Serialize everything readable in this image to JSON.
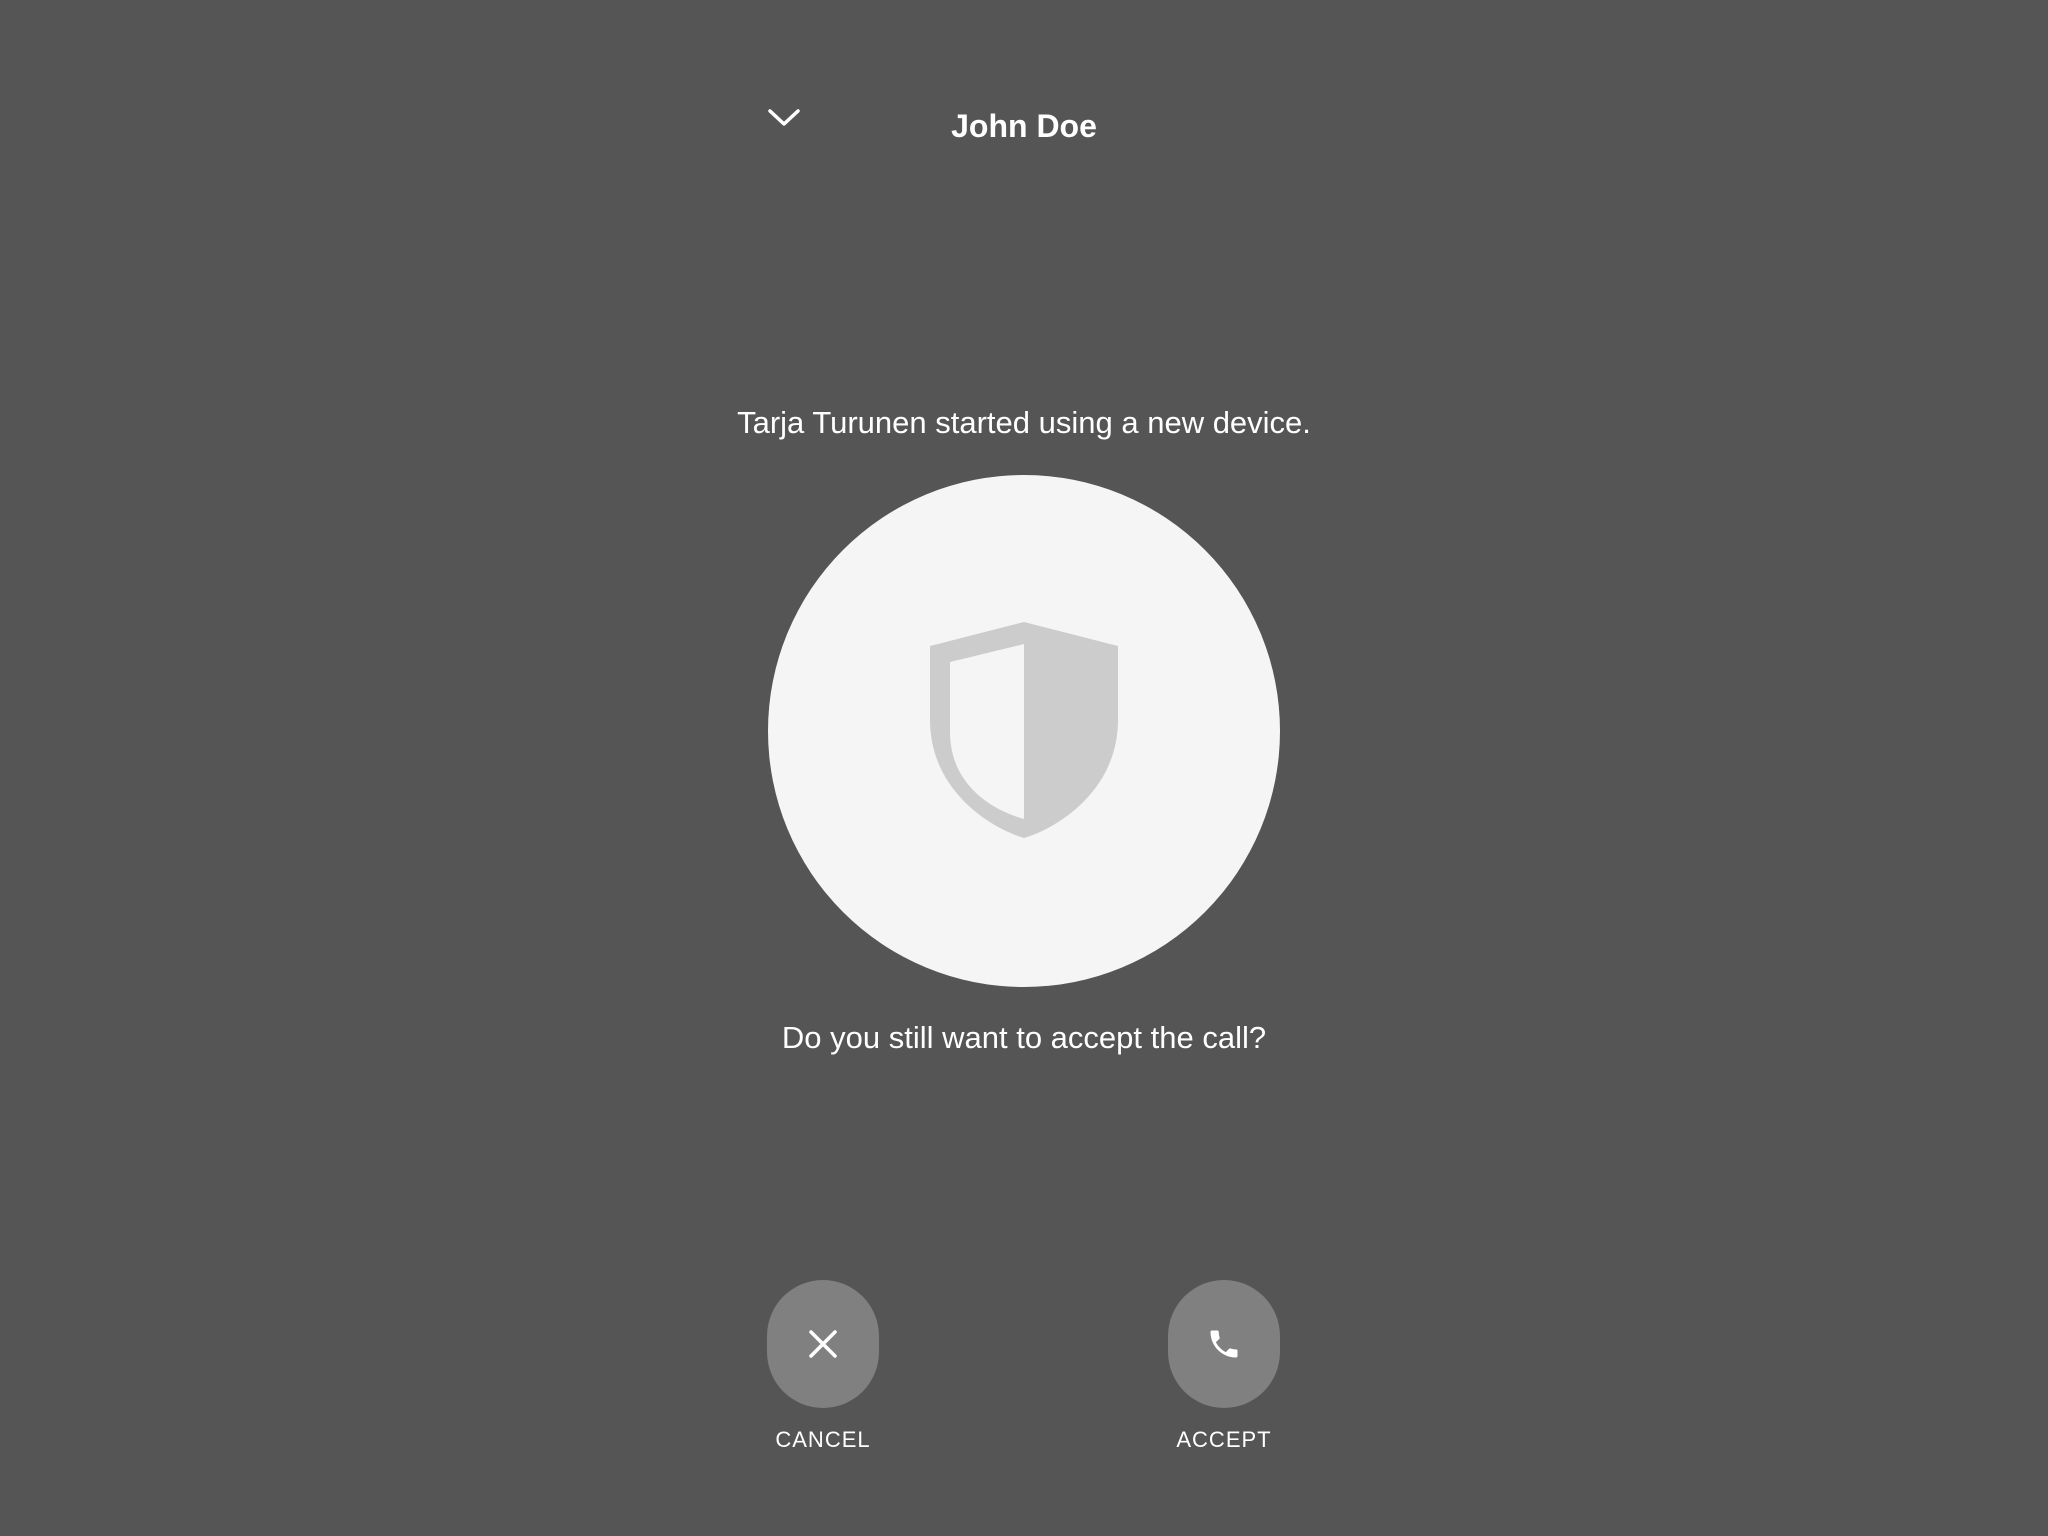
{
  "header": {
    "title": "John Doe",
    "collapse_icon": "chevron-down-icon"
  },
  "main": {
    "device_message": "Tarja Turunen started using a new device.",
    "shield_icon": "shield-icon",
    "question": "Do you still want to accept the call?"
  },
  "actions": {
    "cancel": {
      "label": "CANCEL",
      "icon": "close-icon"
    },
    "accept": {
      "label": "ACCEPT",
      "icon": "phone-icon"
    }
  },
  "colors": {
    "background": "#555555",
    "circle": "#f5f5f5",
    "shield": "#cccccc",
    "button": "#808080",
    "text": "#ffffff"
  }
}
